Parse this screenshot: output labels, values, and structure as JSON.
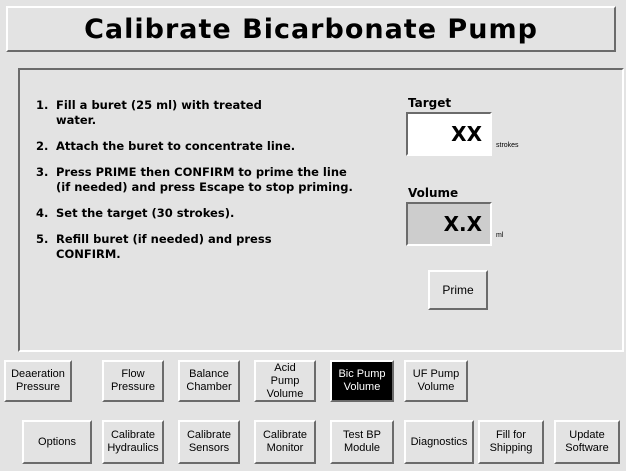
{
  "title": "Calibrate Bicarbonate Pump",
  "instructions": [
    {
      "num": "1.",
      "text": "Fill a buret (25 ml) with treated water."
    },
    {
      "num": "2.",
      "text": "Attach the buret to concentrate line."
    },
    {
      "num": "3.",
      "text": "Press PRIME then CONFIRM to prime the line (if needed) and press Escape to stop priming."
    },
    {
      "num": "4.",
      "text": "Set the target (30 strokes)."
    },
    {
      "num": "5.",
      "text": "Refill buret (if needed) and press CONFIRM."
    }
  ],
  "target": {
    "label": "Target",
    "value": "XX",
    "unit": "strokes"
  },
  "volume": {
    "label": "Volume",
    "value": "X.X",
    "unit": "ml"
  },
  "prime_label": "Prime",
  "sub_tabs": [
    {
      "line1": "Deaeration",
      "line2": "Pressure"
    },
    {
      "line1": "Flow",
      "line2": "Pressure"
    },
    {
      "line1": "Balance",
      "line2": "Chamber"
    },
    {
      "line1": "Acid Pump",
      "line2": "Volume"
    },
    {
      "line1": "Bic Pump",
      "line2": "Volume"
    },
    {
      "line1": "UF Pump",
      "line2": "Volume"
    }
  ],
  "main_tabs": [
    {
      "line1": "Options",
      "line2": ""
    },
    {
      "line1": "Calibrate",
      "line2": "Hydraulics"
    },
    {
      "line1": "Calibrate",
      "line2": "Sensors"
    },
    {
      "line1": "Calibrate",
      "line2": "Monitor"
    },
    {
      "line1": "Test BP",
      "line2": "Module"
    },
    {
      "line1": "Diagnostics",
      "line2": ""
    },
    {
      "line1": "Fill for",
      "line2": "Shipping"
    },
    {
      "line1": "Update",
      "line2": "Software"
    }
  ]
}
